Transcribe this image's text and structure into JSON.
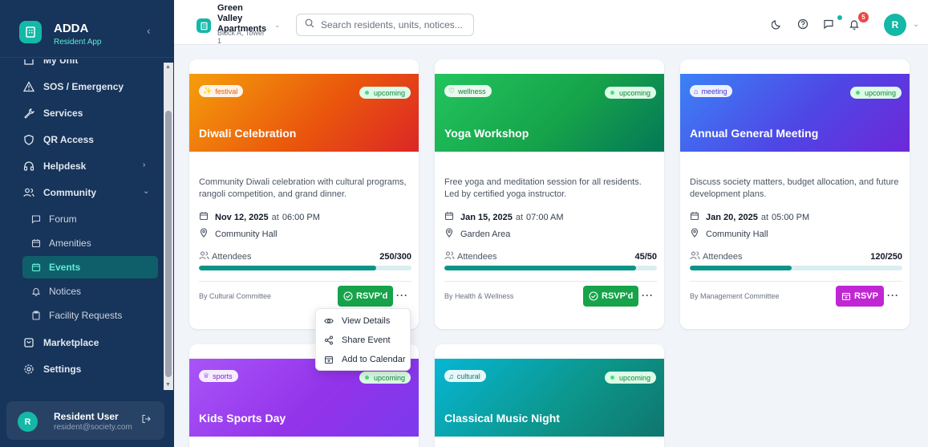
{
  "brand": {
    "name": "ADDA",
    "subtitle": "Resident App"
  },
  "sidebar": {
    "items": [
      {
        "label": "My Unit",
        "icon": "home-icon"
      },
      {
        "label": "SOS / Emergency",
        "icon": "alert-triangle-icon"
      },
      {
        "label": "Services",
        "icon": "wrench-icon"
      },
      {
        "label": "QR Access",
        "icon": "shield-icon"
      },
      {
        "label": "Helpdesk",
        "icon": "headphones-icon"
      },
      {
        "label": "Community",
        "icon": "users-icon"
      },
      {
        "label": "Marketplace",
        "icon": "store-icon"
      },
      {
        "label": "Settings",
        "icon": "gear-icon"
      }
    ],
    "community_sub": [
      {
        "label": "Forum",
        "icon": "message-square-icon"
      },
      {
        "label": "Amenities",
        "icon": "calendar-icon"
      },
      {
        "label": "Events",
        "icon": "calendar-icon",
        "active": true
      },
      {
        "label": "Notices",
        "icon": "bell-icon"
      },
      {
        "label": "Facility Requests",
        "icon": "clipboard-icon"
      }
    ]
  },
  "user": {
    "initial": "R",
    "name": "Resident User",
    "email": "resident@society.com"
  },
  "header": {
    "apartment": "Green Valley Apartments",
    "block": "Block A, Tower 1",
    "search_placeholder": "Search residents, units, notices...",
    "notification_count": "5",
    "avatar_initial": "R"
  },
  "events": [
    {
      "category": "festival",
      "status": "upcoming",
      "title": "Diwali Celebration",
      "description": "Community Diwali celebration with cultural programs, rangoli competition, and grand dinner.",
      "date": "Nov 12, 2025",
      "at": "at",
      "time": "06:00 PM",
      "location": "Community Hall",
      "attendees_label": "Attendees",
      "attendees": "250/300",
      "fill": 0.833,
      "organizer": "By Cultural Committee",
      "rsvp_label": "RSVP'd",
      "rsvp_color": "#16a34a"
    },
    {
      "category": "wellness",
      "status": "upcoming",
      "title": "Yoga Workshop",
      "description": "Free yoga and meditation session for all residents. Led by certified yoga instructor.",
      "date": "Jan 15, 2025",
      "at": "at",
      "time": "07:00 AM",
      "location": "Garden Area",
      "attendees_label": "Attendees",
      "attendees": "45/50",
      "fill": 0.9,
      "organizer": "By Health & Wellness",
      "rsvp_label": "RSVP'd",
      "rsvp_color": "#16a34a"
    },
    {
      "category": "meeting",
      "status": "upcoming",
      "title": "Annual General Meeting",
      "description": "Discuss society matters, budget allocation, and future development plans.",
      "date": "Jan 20, 2025",
      "at": "at",
      "time": "05:00 PM",
      "location": "Community Hall",
      "attendees_label": "Attendees",
      "attendees": "120/250",
      "fill": 0.48,
      "organizer": "By Management Committee",
      "rsvp_label": "RSVP",
      "rsvp_color": "#c026d3"
    },
    {
      "category": "sports",
      "status": "upcoming",
      "title": "Kids Sports Day"
    },
    {
      "category": "cultural",
      "status": "upcoming",
      "title": "Classical Music Night"
    }
  ],
  "colors": {
    "festival": "#ea580c",
    "wellness": "#16a34a",
    "meeting": "#4f46e5",
    "sports": "#9333ea",
    "cultural": "#0d9488",
    "accent": "#14b8a6"
  },
  "dropdown": [
    {
      "label": "View Details",
      "icon": "eye-icon"
    },
    {
      "label": "Share Event",
      "icon": "share-icon"
    },
    {
      "label": "Add to Calendar",
      "icon": "calendar-plus-icon"
    }
  ]
}
